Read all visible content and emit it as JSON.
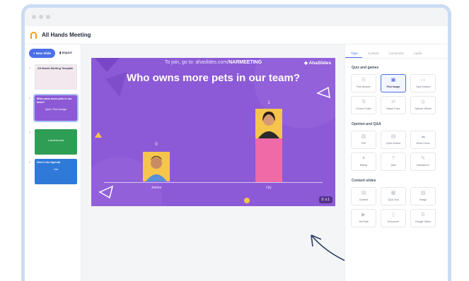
{
  "app": {
    "title": "All Hands Meeting"
  },
  "left_panel": {
    "new_slide_label": "+ New Slide",
    "import_label": "Import",
    "slides": [
      {
        "num": "1",
        "title": "All Hands Meeting Template",
        "label": "",
        "color": "#f3e8ee"
      },
      {
        "num": "2",
        "title": "Who owns more pets in our team?",
        "label": "Quiz: Pick Image",
        "color": "#8c5ad6"
      },
      {
        "num": "3",
        "title": "",
        "label": "Leaderboard",
        "color": "#2f9e55"
      },
      {
        "num": "4",
        "title": "Here's the Agenda",
        "label": "List",
        "color": "#2f7ad8"
      }
    ]
  },
  "slide": {
    "join_text": "To join, go to: ahaslides.com/",
    "join_code": "NARMEETING",
    "brand": "AhaSlides",
    "question": "Who owns more pets in our team?",
    "responses": "0 ♙1",
    "options": [
      {
        "label": "James",
        "value": 0,
        "photo_color": "#f5c64b"
      },
      {
        "label": "Lily",
        "value": 1,
        "photo_color": "#f5c64b"
      }
    ],
    "bar_color": "#ef6aa6",
    "background_color": "#8c5ad6"
  },
  "right_panel": {
    "tabs": [
      "Type",
      "Content",
      "Customize",
      "Audio"
    ],
    "active_tab": "Type",
    "sections": [
      {
        "title": "Quiz and games",
        "items": [
          {
            "label": "Pick Answer",
            "icon": "list-icon",
            "glyph": "☰"
          },
          {
            "label": "Pick Image",
            "icon": "image-icon",
            "glyph": "▣",
            "selected": true
          },
          {
            "label": "Type Answer",
            "icon": "text-icon",
            "glyph": "▭"
          },
          {
            "label": "Correct Order",
            "icon": "order-icon",
            "glyph": "⇅"
          },
          {
            "label": "Match Pairs",
            "icon": "pairs-icon",
            "glyph": "⇄"
          },
          {
            "label": "Spinner Wheel",
            "icon": "wheel-icon",
            "glyph": "◎"
          }
        ]
      },
      {
        "title": "Opinion and Q&A",
        "items": [
          {
            "label": "Poll",
            "icon": "poll-icon",
            "glyph": "▥"
          },
          {
            "label": "Open Ended",
            "icon": "open-ended-icon",
            "glyph": "▤"
          },
          {
            "label": "Word Cloud",
            "icon": "cloud-icon",
            "glyph": "☁"
          },
          {
            "label": "Rating",
            "icon": "rating-icon",
            "glyph": "✦"
          },
          {
            "label": "Q&A",
            "icon": "qa-icon",
            "glyph": "?"
          },
          {
            "label": "Brainstorm",
            "icon": "brainstorm-icon",
            "glyph": "✎"
          }
        ]
      },
      {
        "title": "Content slides",
        "items": [
          {
            "label": "Content",
            "icon": "content-icon",
            "glyph": "▤"
          },
          {
            "label": "Q&A Grid",
            "icon": "grid-icon",
            "glyph": "▦"
          },
          {
            "label": "Image",
            "icon": "picture-icon",
            "glyph": "▨"
          },
          {
            "label": "YouTube",
            "icon": "play-icon",
            "glyph": "▶"
          },
          {
            "label": "Document",
            "icon": "document-icon",
            "glyph": "▯"
          },
          {
            "label": "Google Slides",
            "icon": "google-icon",
            "glyph": "G"
          }
        ]
      }
    ]
  }
}
